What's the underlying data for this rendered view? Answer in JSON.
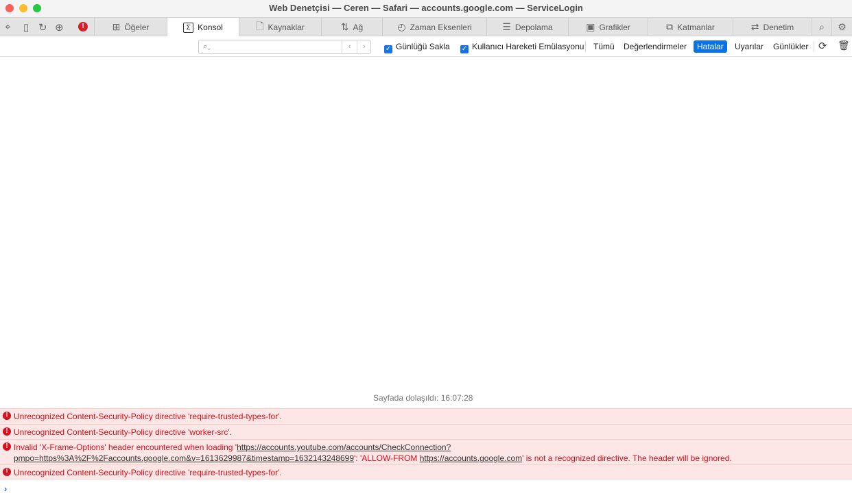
{
  "window": {
    "title": "Web Denetçisi — Ceren — Safari — accounts.google.com — ServiceLogin"
  },
  "tabs": [
    {
      "label": "Öğeler",
      "icon": "elements-icon"
    },
    {
      "label": "Konsol",
      "icon": "console-icon"
    },
    {
      "label": "Kaynaklar",
      "icon": "sources-icon"
    },
    {
      "label": "Ağ",
      "icon": "network-icon"
    },
    {
      "label": "Zaman Eksenleri",
      "icon": "timeline-icon"
    },
    {
      "label": "Depolama",
      "icon": "storage-icon"
    },
    {
      "label": "Grafikler",
      "icon": "graphics-icon"
    },
    {
      "label": "Katmanlar",
      "icon": "layers-icon"
    },
    {
      "label": "Denetim",
      "icon": "audit-icon"
    }
  ],
  "filter": {
    "search_placeholder": "",
    "preserve_log": "Günlüğü Sakla",
    "gesture_emulation": "Kullanıcı Hareketi Emülasyonu",
    "levels": [
      "Tümü",
      "Değerlendirmeler",
      "Hatalar",
      "Uyarılar",
      "Günlükler"
    ],
    "active_level": "Hatalar"
  },
  "console": {
    "navigation": "Sayfada dolaşıldı: 16:07:28",
    "messages": [
      {
        "text": "Unrecognized Content-Security-Policy directive 'require-trusted-types-for'."
      },
      {
        "text": "Unrecognized Content-Security-Policy directive 'worker-src'."
      },
      {
        "pre": "Invalid 'X-Frame-Options' header encountered when loading '",
        "link1": "https://accounts.youtube.com/accounts/CheckConnection?",
        "link1b": "pmpo=https%3A%2F%2Faccounts.google.com&v=1613629987&timestamp=1632143248699",
        "mid": "': 'ALLOW-FROM ",
        "link2": "https://accounts.google.com",
        "post": "' is not a recognized directive. The header will be ignored."
      },
      {
        "text": "Unrecognized Content-Security-Policy directive 'require-trusted-types-for'."
      }
    ],
    "prompt": "›"
  },
  "colors": {
    "error": "#d60f18",
    "error_bg": "#fde6e6",
    "accent": "#0a72e8"
  }
}
